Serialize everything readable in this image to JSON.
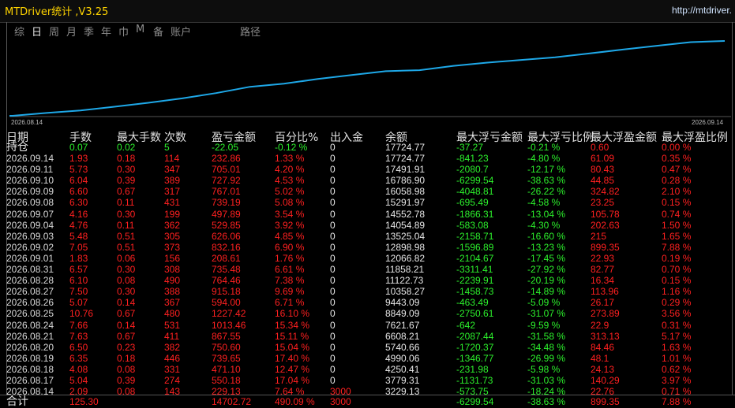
{
  "window": {
    "title": "MTDriver统计 ,V3.25",
    "url": "http://mtdriver."
  },
  "tabs": [
    "综",
    "日",
    "周",
    "月",
    "季",
    "年",
    "巾",
    "M",
    "备",
    "账户",
    "路径"
  ],
  "active_tab": "日",
  "chart": {
    "x_start_label": "2026.08.14",
    "x_end_label": "2026.09.14",
    "line_color": "#1ea8e8",
    "values": [
      3229.13,
      3779.31,
      4250.41,
      4990.06,
      5740.66,
      6608.21,
      7621.67,
      8849.09,
      9443.09,
      10358.27,
      11122.73,
      11858.21,
      12066.82,
      12898.98,
      13525.04,
      14054.89,
      14552.78,
      15291.97,
      16058.98,
      16786.9,
      17491.91,
      17724.77
    ]
  },
  "columns": [
    "日期",
    "手数",
    "最大手数",
    "次数",
    "盈亏金额",
    "百分比%",
    "出入金",
    "余额",
    "最大浮亏金额",
    "最大浮亏比例",
    "最大浮盈金额",
    "最大浮盈比例"
  ],
  "holding": {
    "label": "持仓",
    "lots": "0.07",
    "max_lots": "0.02",
    "count": "5",
    "pnl": "-22.05",
    "pct": "-0.12 %",
    "flow": "0",
    "balance": "17724.77",
    "max_loss": "-37.27",
    "max_loss_pct": "-0.21 %",
    "max_profit": "0.60",
    "max_profit_pct": "0.00 %"
  },
  "rows": [
    {
      "date": "2026.09.14",
      "lots": "1.93",
      "max_lots": "0.18",
      "count": "114",
      "pnl": "232.86",
      "pct": "1.33 %",
      "flow": "0",
      "balance": "17724.77",
      "max_loss": "-841.23",
      "max_loss_pct": "-4.80 %",
      "max_profit": "61.09",
      "max_profit_pct": "0.35 %"
    },
    {
      "date": "2026.09.11",
      "lots": "5.73",
      "max_lots": "0.30",
      "count": "347",
      "pnl": "705.01",
      "pct": "4.20 %",
      "flow": "0",
      "balance": "17491.91",
      "max_loss": "-2080.7",
      "max_loss_pct": "-12.17 %",
      "max_profit": "80.43",
      "max_profit_pct": "0.47 %"
    },
    {
      "date": "2026.09.10",
      "lots": "6.04",
      "max_lots": "0.39",
      "count": "389",
      "pnl": "727.92",
      "pct": "4.53 %",
      "flow": "0",
      "balance": "16786.90",
      "max_loss": "-6299.54",
      "max_loss_pct": "-38.63 %",
      "max_profit": "44.85",
      "max_profit_pct": "0.28 %"
    },
    {
      "date": "2026.09.09",
      "lots": "6.60",
      "max_lots": "0.67",
      "count": "317",
      "pnl": "767.01",
      "pct": "5.02 %",
      "flow": "0",
      "balance": "16058.98",
      "max_loss": "-4048.81",
      "max_loss_pct": "-26.22 %",
      "max_profit": "324.82",
      "max_profit_pct": "2.10 %"
    },
    {
      "date": "2026.09.08",
      "lots": "6.30",
      "max_lots": "0.11",
      "count": "431",
      "pnl": "739.19",
      "pct": "5.08 %",
      "flow": "0",
      "balance": "15291.97",
      "max_loss": "-695.49",
      "max_loss_pct": "-4.58 %",
      "max_profit": "23.25",
      "max_profit_pct": "0.15 %"
    },
    {
      "date": "2026.09.07",
      "lots": "4.16",
      "max_lots": "0.30",
      "count": "199",
      "pnl": "497.89",
      "pct": "3.54 %",
      "flow": "0",
      "balance": "14552.78",
      "max_loss": "-1866.31",
      "max_loss_pct": "-13.04 %",
      "max_profit": "105.78",
      "max_profit_pct": "0.74 %"
    },
    {
      "date": "2026.09.04",
      "lots": "4.76",
      "max_lots": "0.11",
      "count": "362",
      "pnl": "529.85",
      "pct": "3.92 %",
      "flow": "0",
      "balance": "14054.89",
      "max_loss": "-583.08",
      "max_loss_pct": "-4.30 %",
      "max_profit": "202.63",
      "max_profit_pct": "1.50 %"
    },
    {
      "date": "2026.09.03",
      "lots": "5.48",
      "max_lots": "0.51",
      "count": "305",
      "pnl": "626.06",
      "pct": "4.85 %",
      "flow": "0",
      "balance": "13525.04",
      "max_loss": "-2158.71",
      "max_loss_pct": "-16.60 %",
      "max_profit": "215",
      "max_profit_pct": "1.65 %"
    },
    {
      "date": "2026.09.02",
      "lots": "7.05",
      "max_lots": "0.51",
      "count": "373",
      "pnl": "832.16",
      "pct": "6.90 %",
      "flow": "0",
      "balance": "12898.98",
      "max_loss": "-1596.89",
      "max_loss_pct": "-13.23 %",
      "max_profit": "899.35",
      "max_profit_pct": "7.88 %"
    },
    {
      "date": "2026.09.01",
      "lots": "1.83",
      "max_lots": "0.06",
      "count": "156",
      "pnl": "208.61",
      "pct": "1.76 %",
      "flow": "0",
      "balance": "12066.82",
      "max_loss": "-2104.67",
      "max_loss_pct": "-17.45 %",
      "max_profit": "22.93",
      "max_profit_pct": "0.19 %"
    },
    {
      "date": "2026.08.31",
      "lots": "6.57",
      "max_lots": "0.30",
      "count": "308",
      "pnl": "735.48",
      "pct": "6.61 %",
      "flow": "0",
      "balance": "11858.21",
      "max_loss": "-3311.41",
      "max_loss_pct": "-27.92 %",
      "max_profit": "82.77",
      "max_profit_pct": "0.70 %"
    },
    {
      "date": "2026.08.28",
      "lots": "6.10",
      "max_lots": "0.08",
      "count": "490",
      "pnl": "764.46",
      "pct": "7.38 %",
      "flow": "0",
      "balance": "11122.73",
      "max_loss": "-2239.91",
      "max_loss_pct": "-20.19 %",
      "max_profit": "16.34",
      "max_profit_pct": "0.15 %"
    },
    {
      "date": "2026.08.27",
      "lots": "7.50",
      "max_lots": "0.30",
      "count": "388",
      "pnl": "915.18",
      "pct": "9.69 %",
      "flow": "0",
      "balance": "10358.27",
      "max_loss": "-1458.73",
      "max_loss_pct": "-14.89 %",
      "max_profit": "113.96",
      "max_profit_pct": "1.16 %"
    },
    {
      "date": "2026.08.26",
      "lots": "5.07",
      "max_lots": "0.14",
      "count": "367",
      "pnl": "594.00",
      "pct": "6.71 %",
      "flow": "0",
      "balance": "9443.09",
      "max_loss": "-463.49",
      "max_loss_pct": "-5.09 %",
      "max_profit": "26.17",
      "max_profit_pct": "0.29 %"
    },
    {
      "date": "2026.08.25",
      "lots": "10.76",
      "max_lots": "0.67",
      "count": "480",
      "pnl": "1227.42",
      "pct": "16.10 %",
      "flow": "0",
      "balance": "8849.09",
      "max_loss": "-2750.61",
      "max_loss_pct": "-31.07 %",
      "max_profit": "273.89",
      "max_profit_pct": "3.56 %"
    },
    {
      "date": "2026.08.24",
      "lots": "7.66",
      "max_lots": "0.14",
      "count": "531",
      "pnl": "1013.46",
      "pct": "15.34 %",
      "flow": "0",
      "balance": "7621.67",
      "max_loss": "-642",
      "max_loss_pct": "-9.59 %",
      "max_profit": "22.9",
      "max_profit_pct": "0.31 %"
    },
    {
      "date": "2026.08.21",
      "lots": "7.63",
      "max_lots": "0.67",
      "count": "411",
      "pnl": "867.55",
      "pct": "15.11 %",
      "flow": "0",
      "balance": "6608.21",
      "max_loss": "-2087.44",
      "max_loss_pct": "-31.58 %",
      "max_profit": "313.13",
      "max_profit_pct": "5.17 %"
    },
    {
      "date": "2026.08.20",
      "lots": "6.50",
      "max_lots": "0.23",
      "count": "382",
      "pnl": "750.60",
      "pct": "15.04 %",
      "flow": "0",
      "balance": "5740.66",
      "max_loss": "-1720.37",
      "max_loss_pct": "-34.48 %",
      "max_profit": "84.46",
      "max_profit_pct": "1.63 %"
    },
    {
      "date": "2026.08.19",
      "lots": "6.35",
      "max_lots": "0.18",
      "count": "446",
      "pnl": "739.65",
      "pct": "17.40 %",
      "flow": "0",
      "balance": "4990.06",
      "max_loss": "-1346.77",
      "max_loss_pct": "-26.99 %",
      "max_profit": "48.1",
      "max_profit_pct": "1.01 %"
    },
    {
      "date": "2026.08.18",
      "lots": "4.08",
      "max_lots": "0.08",
      "count": "331",
      "pnl": "471.10",
      "pct": "12.47 %",
      "flow": "0",
      "balance": "4250.41",
      "max_loss": "-231.98",
      "max_loss_pct": "-5.98 %",
      "max_profit": "24.13",
      "max_profit_pct": "0.62 %"
    },
    {
      "date": "2026.08.17",
      "lots": "5.04",
      "max_lots": "0.39",
      "count": "274",
      "pnl": "550.18",
      "pct": "17.04 %",
      "flow": "0",
      "balance": "3779.31",
      "max_loss": "-1131.73",
      "max_loss_pct": "-31.03 %",
      "max_profit": "140.29",
      "max_profit_pct": "3.97 %"
    },
    {
      "date": "2026.08.14",
      "lots": "2.09",
      "max_lots": "0.08",
      "count": "143",
      "pnl": "229.13",
      "pct": "7.64 %",
      "flow": "3000",
      "balance": "3229.13",
      "max_loss": "-573.75",
      "max_loss_pct": "-18.24 %",
      "max_profit": "22.76",
      "max_profit_pct": "0.71 %"
    }
  ],
  "total": {
    "label": "合计",
    "lots": "125.30",
    "pnl": "14702.72",
    "pct": "490.09 %",
    "flow": "3000",
    "max_loss": "-6299.54",
    "max_loss_pct": "-38.63 %",
    "max_profit": "899.35",
    "max_profit_pct": "7.88 %"
  }
}
